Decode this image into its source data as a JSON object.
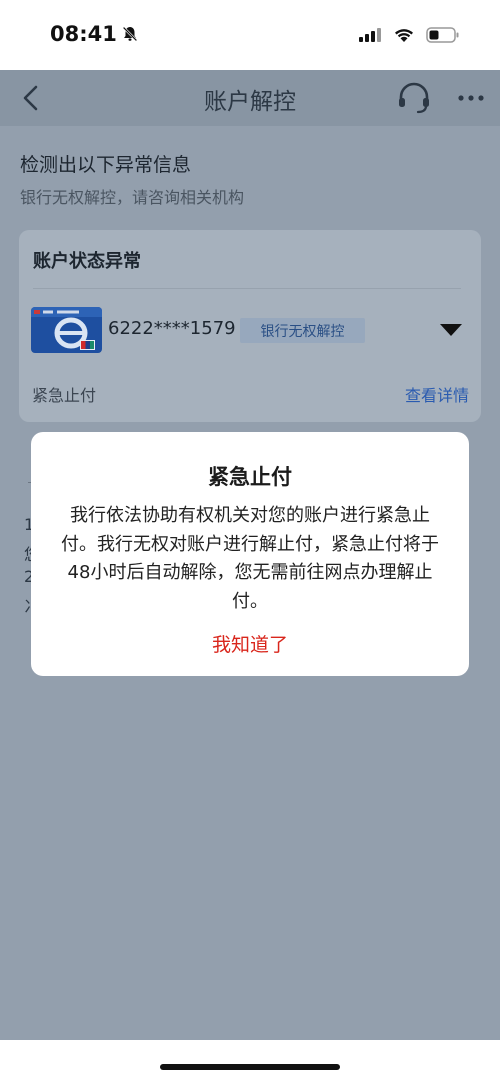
{
  "status_bar": {
    "time": "08:41"
  },
  "nav": {
    "title": "账户解控"
  },
  "main": {
    "detect_title": "检测出以下异常信息",
    "detect_subtitle": "银行无权解控，请咨询相关机构"
  },
  "status_card": {
    "title": "账户状态异常",
    "card_number": "6222****1579",
    "tag": "银行无权解控",
    "footer_label": "紧急止付",
    "footer_link": "查看详情"
  },
  "background_fragments": [
    "1",
    "您",
    "2",
    "冫"
  ],
  "modal": {
    "title": "紧急止付",
    "body": "我行依法协助有权机关对您的账户进行紧急止付。我行无权对账户进行解止付，紧急止付将于48小时后自动解除，您无需前往网点办理解止付。",
    "confirm": "我知道了"
  },
  "colors": {
    "overlay": "#939fad",
    "link": "#2a5bb0",
    "confirm": "#d9261c"
  }
}
